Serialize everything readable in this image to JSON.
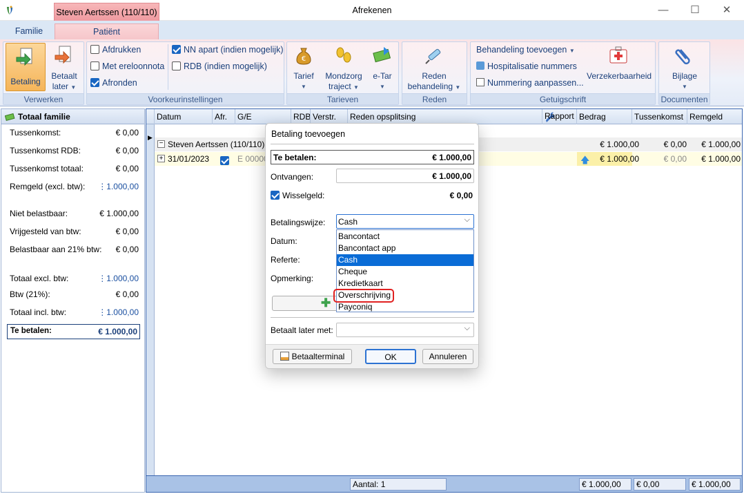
{
  "window": {
    "title": "Afrekenen",
    "context_tab": "Steven Aertssen (110/110)",
    "minimize": "—",
    "maximize": "☐",
    "close": "✕"
  },
  "ribbon_tabs": [
    "Familie",
    "Patiënt"
  ],
  "ribbon": {
    "verwerken": {
      "label": "Verwerken",
      "betaling": "Betaling",
      "betaalt_later_1": "Betaalt",
      "betaalt_later_2": "later"
    },
    "voorkeur": {
      "label": "Voorkeurinstellingen",
      "afdrukken": "Afdrukken",
      "met_ereloonnota": "Met ereloonnota",
      "afronden": "Afronden",
      "nn_apart": "NN apart (indien mogelijk)",
      "rdb": "RDB (indien mogelijk)"
    },
    "tarieven": {
      "label": "Tarieven",
      "tarief": "Tarief",
      "mondzorg_1": "Mondzorg",
      "mondzorg_2": "traject",
      "etar": "e-Tar"
    },
    "reden": {
      "label": "Reden",
      "reden_1": "Reden",
      "reden_2": "behandeling"
    },
    "getuigschrift": {
      "label": "Getuigschrift",
      "behandeling_toevoegen": "Behandeling toevoegen",
      "hospitalisatie": "Hospitalisatie nummers",
      "nummering": "Nummering aanpassen...",
      "verzekerbaarheid": "Verzekerbaarheid"
    },
    "documenten": {
      "label": "Documenten",
      "bijlage": "Bijlage"
    }
  },
  "left_pane": {
    "title": "Totaal familie",
    "rows": [
      {
        "label": "Tussenkomst:",
        "value": "€ 0,00"
      },
      {
        "label": "Tussenkomst RDB:",
        "value": "€ 0,00"
      },
      {
        "label": "Tussenkomst totaal:",
        "value": "€ 0,00"
      },
      {
        "label": "Remgeld (excl. btw):",
        "value": "1.000,00"
      },
      {
        "label": "Niet belastbaar:",
        "value": "€ 1.000,00"
      },
      {
        "label": "Vrijgesteld van btw:",
        "value": "€ 0,00"
      },
      {
        "label": "Belastbaar aan 21% btw:",
        "value": "€ 0,00"
      },
      {
        "label": "Totaal excl. btw:",
        "value": "1.000,00"
      },
      {
        "label": "Btw (21%):",
        "value": "€ 0,00"
      },
      {
        "label": "Totaal incl. btw:",
        "value": "1.000,00"
      }
    ],
    "te_betalen_label": "Te betalen:",
    "te_betalen_value": "€ 1.000,00"
  },
  "grid": {
    "columns": [
      "Datum",
      "Afr.",
      "G/E",
      "RDB",
      "Verstr.",
      "Reden opsplitsing",
      "Rapport",
      "Bedrag",
      "Tussenkomst",
      "Remgeld"
    ],
    "group_row": {
      "name": "Steven Aertssen (110/110)",
      "bedrag": "€ 1.000,00",
      "tussenkomst": "€ 0,00",
      "remgeld": "€ 1.000,00"
    },
    "data_row": {
      "datum": "31/01/2023",
      "ge": "E 000000",
      "bedrag": "€ 1.000,00",
      "tussenkomst": "€ 0,00",
      "remgeld": "€ 1.000,00"
    },
    "footer": {
      "aantal": "Aantal: 1",
      "bedrag": "€ 1.000,00",
      "tussenkomst": "€ 0,00",
      "remgeld": "€ 1.000,00"
    }
  },
  "dialog": {
    "title": "Betaling toevoegen",
    "te_betalen_label": "Te betalen:",
    "te_betalen_value": "€ 1.000,00",
    "ontvangen_label": "Ontvangen:",
    "ontvangen_value": "€ 1.000,00",
    "wisselgeld_label": "Wisselgeld:",
    "wisselgeld_value": "€ 0,00",
    "betalingswijze_label": "Betalingswijze:",
    "betalingswijze_value": "Cash",
    "datum_label": "Datum:",
    "referte_label": "Referte:",
    "opmerking_label": "Opmerking:",
    "options": [
      "Bancontact",
      "Bancontact app",
      "Cash",
      "Cheque",
      "Kredietkaart",
      "Overschrijving",
      "Payconiq"
    ],
    "selected_option": "Cash",
    "highlighted_option": "Overschrijving",
    "betaalt_later_label": "Betaalt later met:",
    "betaalt_later_value": "",
    "betaalterminal_button": "Betaalterminal",
    "ok_button": "OK",
    "annuleren_button": "Annuleren"
  },
  "colors": {
    "ribbon_pink": "#fbe3e5",
    "ribbon_blue": "#dbe7f5",
    "selection": "#0a6cd6",
    "highlight": "#e02020",
    "accent_border": "#3a66b0"
  }
}
